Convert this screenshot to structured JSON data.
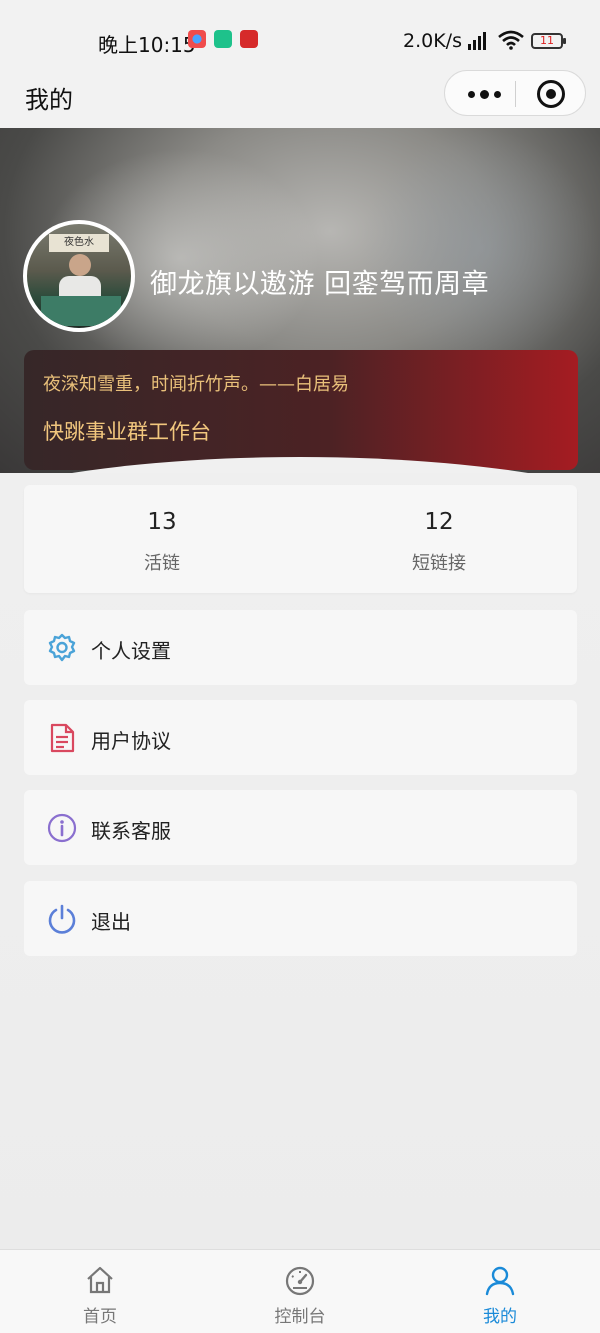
{
  "status_bar": {
    "time": "晚上10:15",
    "net_speed": "2.0K/s",
    "battery": "11"
  },
  "navbar": {
    "title": "我的"
  },
  "profile": {
    "avatar_sign_text": "夜色水",
    "name": "御龙旗以遨游 回銮驾而周章",
    "quote": "夜深知雪重，时闻折竹声。——白居易",
    "workspace": "快跳事业群工作台"
  },
  "stats": [
    {
      "value": "13",
      "label": "活链"
    },
    {
      "value": "12",
      "label": "短链接"
    }
  ],
  "menu": [
    {
      "label": "个人设置",
      "icon": "gear-icon",
      "color": "#4aa3d8"
    },
    {
      "label": "用户协议",
      "icon": "document-icon",
      "color": "#d9485f"
    },
    {
      "label": "联系客服",
      "icon": "info-icon",
      "color": "#8a6fcf"
    },
    {
      "label": "退出",
      "icon": "power-icon",
      "color": "#5b7fd8"
    }
  ],
  "tabbar": {
    "tabs": [
      {
        "label": "首页",
        "icon": "home-icon",
        "active": false
      },
      {
        "label": "控制台",
        "icon": "dashboard-icon",
        "active": false
      },
      {
        "label": "我的",
        "icon": "user-icon",
        "active": true
      }
    ],
    "active_color": "#1a8ad8"
  }
}
